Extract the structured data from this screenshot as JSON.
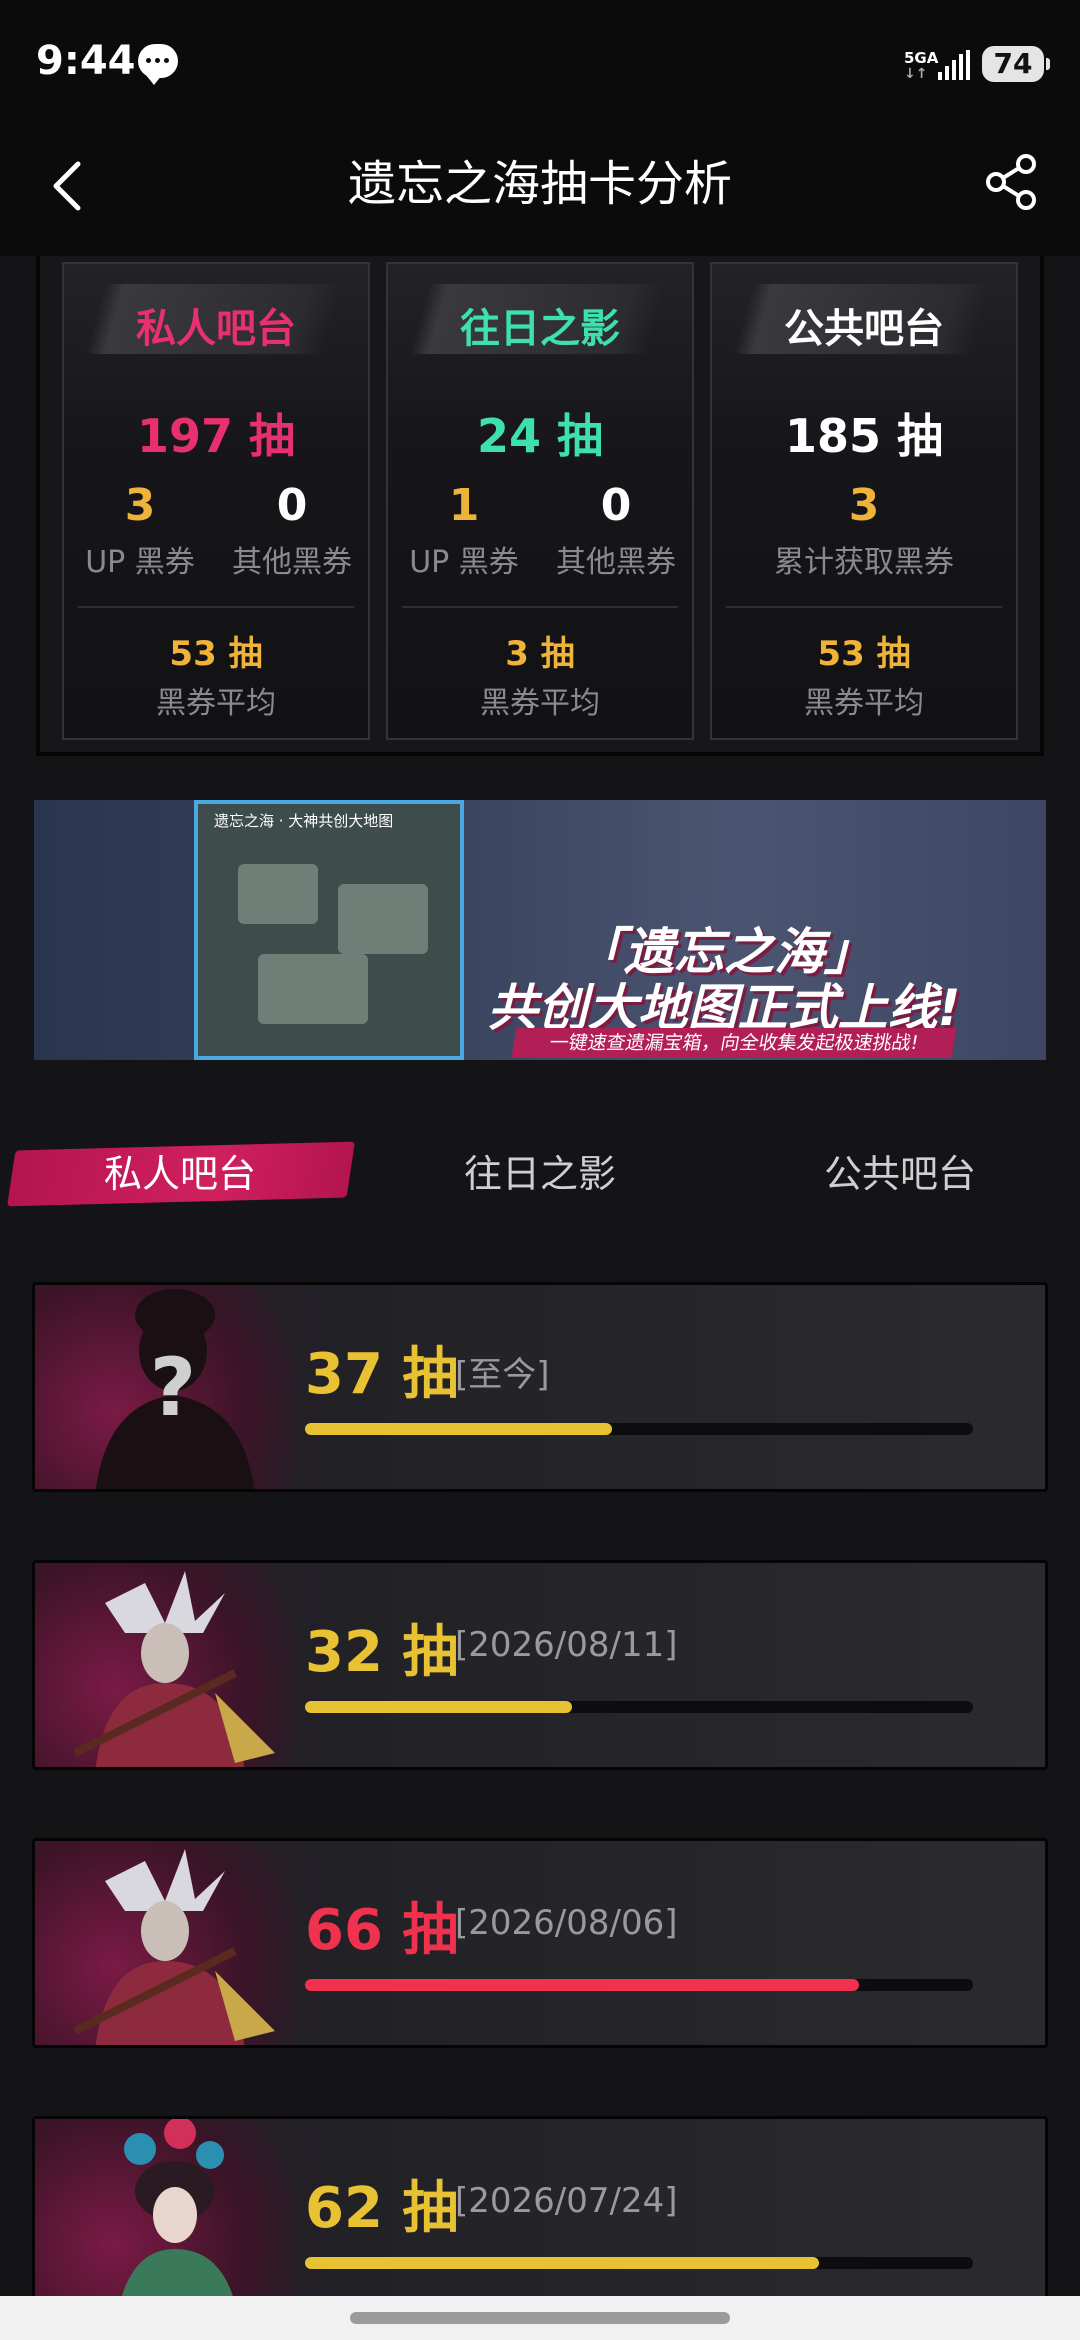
{
  "status_bar": {
    "time": "9:44",
    "network": "5GA",
    "battery": "74"
  },
  "header": {
    "title": "遗忘之海抽卡分析"
  },
  "stats": [
    {
      "name": "私人吧台",
      "name_color": "#e8306e",
      "total": "197 抽",
      "total_color": "#e8306e",
      "left_value": "3",
      "left_label": "UP 黑券",
      "right_value": "0",
      "right_label": "其他黑券",
      "avg_value": "53 抽",
      "avg_label": "黑券平均"
    },
    {
      "name": "往日之影",
      "name_color": "#3ee0b0",
      "total": "24 抽",
      "total_color": "#3ee0b0",
      "left_value": "1",
      "left_label": "UP 黑券",
      "right_value": "0",
      "right_label": "其他黑券",
      "avg_value": "3 抽",
      "avg_label": "黑券平均"
    },
    {
      "name": "公共吧台",
      "name_color": "#ffffff",
      "total": "185 抽",
      "total_color": "#ffffff",
      "center_value": "3",
      "center_label": "累计获取黑券",
      "avg_value": "53 抽",
      "avg_label": "黑券平均"
    }
  ],
  "banner": {
    "map_title": "遗忘之海 · 大神共创大地图",
    "title_line1": "「遗忘之海」",
    "title_line2": "共创大地图正式上线!",
    "subtitle": "一键速查遗漏宝箱，向全收集发起极速挑战!"
  },
  "tabs": {
    "active": "私人吧台",
    "items": [
      "私人吧台",
      "往日之影",
      "公共吧台"
    ]
  },
  "records": [
    {
      "count": "37 抽",
      "date": "[至今]",
      "progress": 0.46,
      "color": "#e9c234",
      "avatar": "unknown-silhouette"
    },
    {
      "count": "32 抽",
      "date": "[2026/08/11]",
      "progress": 0.4,
      "color": "#e9c234",
      "avatar": "white-haired-guitarist"
    },
    {
      "count": "66 抽",
      "date": "[2026/08/06]",
      "progress": 0.83,
      "color": "#f0324e",
      "avatar": "white-haired-guitarist"
    },
    {
      "count": "62 抽",
      "date": "[2026/07/24]",
      "progress": 0.77,
      "color": "#e9c234",
      "avatar": "flower-crowned-performer"
    }
  ],
  "colors": {
    "accent_pink": "#d0205e",
    "gold": "#f0b33a",
    "yellow_bar": "#e9c234",
    "red_bar": "#f0324e"
  }
}
